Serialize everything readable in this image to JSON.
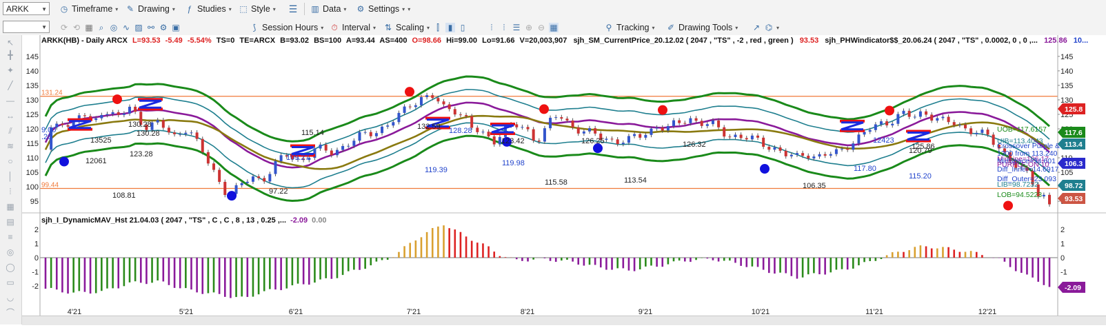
{
  "toolbar": {
    "symbol": "ARKK",
    "timeframe": "Timeframe",
    "drawing": "Drawing",
    "studies": "Studies",
    "style": "Style",
    "data": "Data",
    "settings": "Settings"
  },
  "toolbar2": {
    "session_hours": "Session Hours",
    "interval": "Interval",
    "scaling": "Scaling",
    "tracking": "Tracking",
    "drawing_tools": "Drawing Tools"
  },
  "header": {
    "symbol_info": "ARKK(HB) - Daily  ARCX",
    "last": "L=93.53",
    "change": "-5.49",
    "pct": "-5.54%",
    "ts": "TS=0",
    "te": "TE=ARCX",
    "bid": "B=93.02",
    "bs": "BS=100",
    "ask": "A=93.44",
    "as": "AS=400",
    "open": "O=98.66",
    "high": "Hi=99.00",
    "low": "Lo=91.66",
    "volume": "V=20,003,907",
    "study1": "sjh_SM_CurrentPrice_20.12.02 ( 2047 , \"TS\" , -2 , red , green )",
    "study1_val": "93.53",
    "study2": "sjh_PHWindicator$$_20.06.24 ( 2047 ,  \"TS\" , 0.0002,   0 ,   0 ,...",
    "study2_val": "125.86",
    "study2_val2": "10..."
  },
  "subheader": {
    "study": "sjh_I_DynamicMAV_Hst 21.04.03 ( 2047 , \"TS\" , C , C ,  8 , 13 , 0.25 ,...",
    "val1": "-2.09",
    "val2": "0.00"
  },
  "price_axis": [
    "145",
    "140",
    "135",
    "130",
    "125",
    "120",
    "115",
    "110",
    "105",
    "100",
    "95"
  ],
  "osc_axis": [
    "2",
    "1",
    "0",
    "-1",
    "-2"
  ],
  "x_axis": [
    "4'21",
    "5'21",
    "6'21",
    "7'21",
    "8'21",
    "9'21",
    "10'21",
    "11'21",
    "12'21"
  ],
  "horizontal_lines": {
    "upper": "131.24",
    "lower": "99.44"
  },
  "price_labels": {
    "first_left": "9.00",
    "first_left2": ".20",
    "l1": "130.28",
    "l2": "130.28",
    "l3": "123.28",
    "l4": "108.81",
    "l5": "97.22",
    "l6": "115.14",
    "l7": "109.27",
    "l8": "132.59",
    "l9": "128.28",
    "l10": "119.39",
    "l11": "123.42",
    "l12": "119.98",
    "l13": "115.58",
    "l14": "126.25",
    "l15": "113.54",
    "l16": "126.32",
    "l17": "106.35",
    "l18": "125.86",
    "l19": "120.79",
    "l20": "115.20",
    "l21": "117.80",
    "l22": "12423",
    "l23": "13525",
    "l24": "12061"
  },
  "right_labels": {
    "uob": "UOB=117.6157",
    "uib": "UIB=113.4043",
    "crossover": "Crossover Purple &",
    "from": "1300 from 113.240",
    "midline": "MidLine=106.17",
    "midspace": "MidSpace=34.601",
    "purple_on": "PURPLE ON 10",
    "diff_inner": "Diff_Inner=14.6917",
    "diff_outer": "Diff_Outer=23.093",
    "lib": "LIB=98.7232",
    "lob": "LOB=94.5223"
  },
  "right_tags": {
    "t1": "125.8",
    "t2": "117.6",
    "t3": "113.4",
    "t4": "106.3",
    "t5": "98.72",
    "t6": "93.53",
    "t7": "-2.09"
  },
  "colors": {
    "green_band": "#1a8a1a",
    "teal_band": "#1f7f8f",
    "purple_mid": "#8a1a9a",
    "olive_mid": "#8a7a10",
    "hline": "#f07a3a",
    "up_bar": "#3355cc",
    "down_bar": "#cc3333",
    "osc_green": "#2a8a1a",
    "osc_purple": "#8a1a9a",
    "osc_orange": "#d9a030",
    "osc_red": "#dd2222"
  }
}
